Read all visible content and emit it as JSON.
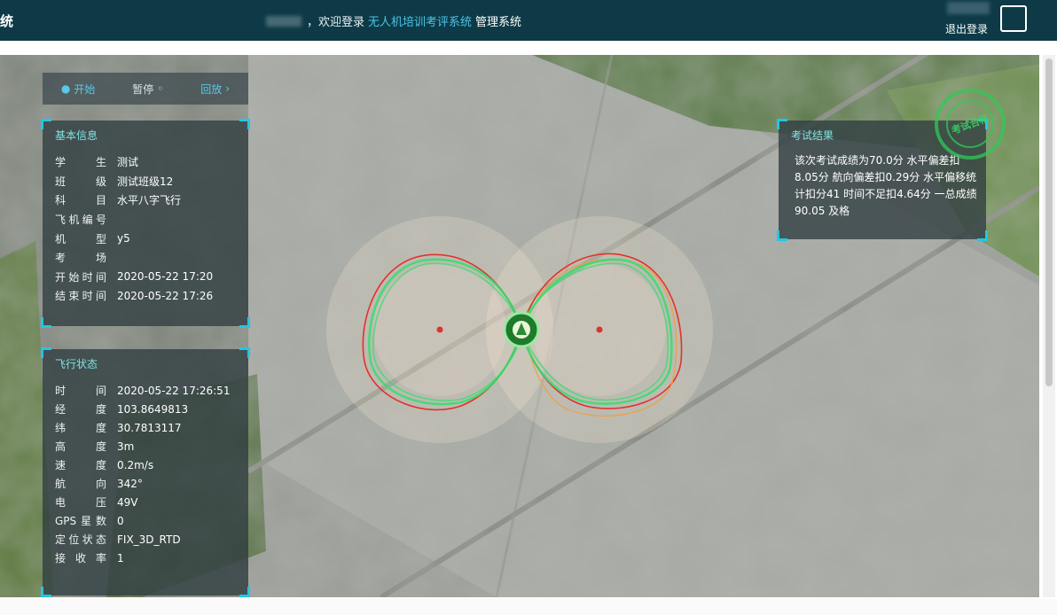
{
  "header": {
    "brand": "统",
    "welcome_prefix": "，欢迎登录",
    "system_name": "无人机培训考评系统",
    "system_suffix": "管理系统",
    "logout": "退出登录"
  },
  "toolbar": {
    "items": [
      {
        "label": "开始",
        "icon": "play-icon"
      },
      {
        "label": "暂停",
        "icon": "pause-icon"
      },
      {
        "label": "回放",
        "icon": "chevron-right-icon"
      }
    ]
  },
  "info_panel": {
    "title": "基本信息",
    "rows": [
      {
        "label": "学生",
        "value": "测试"
      },
      {
        "label": "班级",
        "value": "测试班级12"
      },
      {
        "label": "科目",
        "value": "水平八字飞行"
      },
      {
        "label": "飞机编号",
        "value": ""
      },
      {
        "label": "机型",
        "value": "y5"
      },
      {
        "label": "考场",
        "value": ""
      },
      {
        "label": "开始时间",
        "value": "2020-05-22 17:20"
      },
      {
        "label": "结束时间",
        "value": "2020-05-22 17:26"
      }
    ]
  },
  "status_panel": {
    "title": "飞行状态",
    "rows": [
      {
        "label": "时间",
        "value": "2020-05-22 17:26:51"
      },
      {
        "label": "经度",
        "value": "103.8649813"
      },
      {
        "label": "纬度",
        "value": "30.7813117"
      },
      {
        "label": "高度",
        "value": "3m"
      },
      {
        "label": "速度",
        "value": "0.2m/s"
      },
      {
        "label": "航向",
        "value": "342°"
      },
      {
        "label": "电压",
        "value": "49V"
      },
      {
        "label": "GPS星数",
        "value": "0"
      },
      {
        "label": "定位状态",
        "value": "FIX_3D_RTD"
      },
      {
        "label": "接收率",
        "value": "1"
      }
    ]
  },
  "result_panel": {
    "title": "考试结果",
    "text": "该次考试成绩为70.0分 水平偏差扣8.05分 航向偏差扣0.29分 水平偏移统计扣分41 时间不足扣4.64分 一总成绩90.05 及格"
  },
  "stamp": {
    "text": "考试合格"
  },
  "track_colors": {
    "green": "#2ee06a",
    "red": "#e0322c",
    "orange": "#f0a040"
  }
}
